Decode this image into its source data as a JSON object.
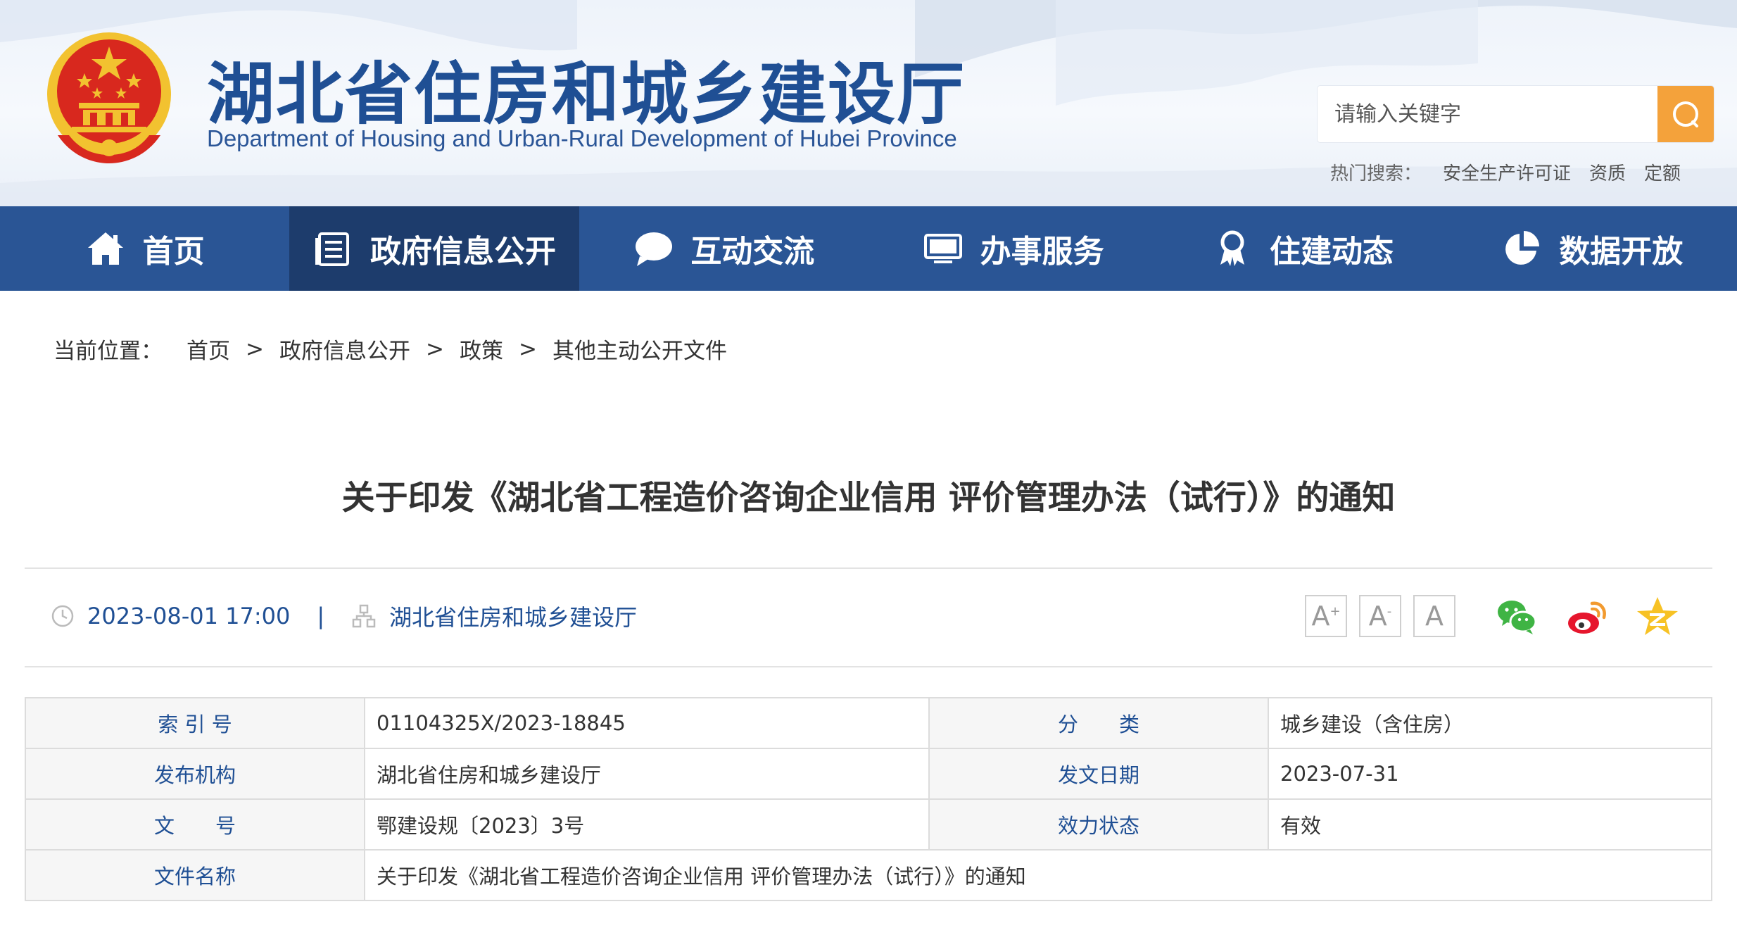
{
  "header": {
    "site_title": "湖北省住房和城乡建设厅",
    "site_subtitle": "Department of Housing and Urban-Rural Development of Hubei Province",
    "search_placeholder": "请输入关键字",
    "hot_label": "热门搜索：",
    "hot_keywords": [
      "安全生产许可证",
      "资质",
      "定额"
    ]
  },
  "nav": [
    {
      "label": "首页",
      "icon": "home-icon"
    },
    {
      "label": "政府信息公开",
      "icon": "document-list-icon",
      "active": true
    },
    {
      "label": "互动交流",
      "icon": "chat-bubble-icon"
    },
    {
      "label": "办事服务",
      "icon": "monitor-icon"
    },
    {
      "label": "住建动态",
      "icon": "award-ribbon-icon"
    },
    {
      "label": "数据开放",
      "icon": "pie-chart-icon"
    }
  ],
  "breadcrumb": {
    "label": "当前位置：",
    "items": [
      "首页",
      "政府信息公开",
      "政策",
      "其他主动公开文件"
    ],
    "separator": ">"
  },
  "article": {
    "title": "关于印发《湖北省工程造价咨询企业信用 评价管理办法（试行）》的通知",
    "datetime": "2023-08-01 17:00",
    "meta_separator": "|",
    "source": "湖北省住房和城乡建设厅"
  },
  "font_controls": [
    {
      "label": "A",
      "sup": "+",
      "icon": "font-increase-icon"
    },
    {
      "label": "A",
      "sup": "-",
      "icon": "font-decrease-icon"
    },
    {
      "label": "A",
      "sup": "",
      "icon": "font-reset-icon"
    }
  ],
  "share": [
    "wechat-icon",
    "weibo-icon",
    "qzone-icon"
  ],
  "info_table": {
    "row1": {
      "k1": "索 引 号",
      "v1": "01104325X/2023-18845",
      "k2": "分　　类",
      "v2": "城乡建设（含住房）"
    },
    "row2": {
      "k1": "发布机构",
      "v1": "湖北省住房和城乡建设厅",
      "k2": "发文日期",
      "v2": "2023-07-31"
    },
    "row3": {
      "k1": "文　　号",
      "v1": "鄂建设规〔2023〕3号",
      "k2": "效力状态",
      "v2": "有效"
    },
    "row4": {
      "k1": "文件名称",
      "v1": "关于印发《湖北省工程造价咨询企业信用 评价管理办法（试行）》的通知"
    }
  },
  "colors": {
    "nav_bg": "#2a5595",
    "nav_active": "#1d3c6c",
    "accent_blue": "#1f4f94",
    "search_button": "#f4a23b",
    "emblem_red": "#d8281e",
    "emblem_gold": "#f2c230"
  }
}
